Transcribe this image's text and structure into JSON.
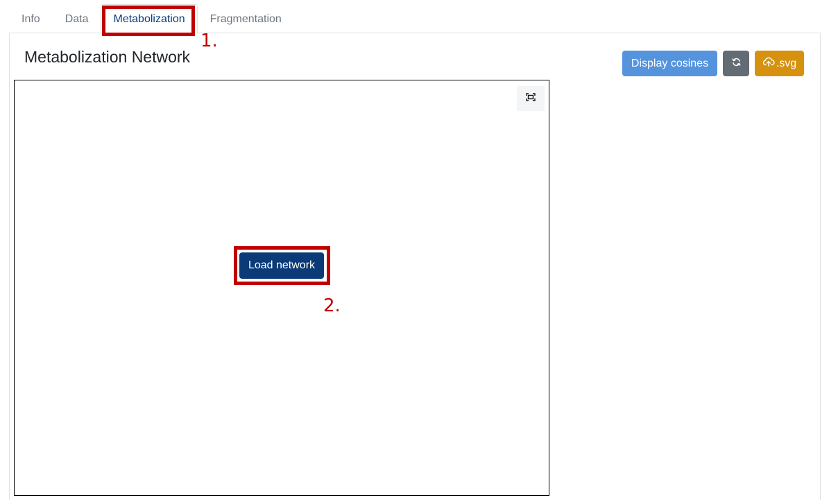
{
  "tabs": [
    {
      "label": "Info"
    },
    {
      "label": "Data"
    },
    {
      "label": "Metabolization"
    },
    {
      "label": "Fragmentation"
    }
  ],
  "active_tab": "Metabolization",
  "page_title": "Metabolization Network",
  "toolbar": {
    "display_cosines_label": "Display cosines",
    "refresh_icon": "refresh-icon",
    "download_icon": "cloud-upload-icon",
    "svg_label": ".svg"
  },
  "network": {
    "fit_icon": "fit-to-screen-icon",
    "load_button_label": "Load network"
  },
  "annotations": {
    "step1": "1.",
    "step2": "2."
  },
  "colors": {
    "annotation_red": "#c00000",
    "primary_dark": "#0a3a78",
    "info_blue": "#5593dc",
    "secondary": "#636b75",
    "warning_gold": "#d6920f"
  }
}
